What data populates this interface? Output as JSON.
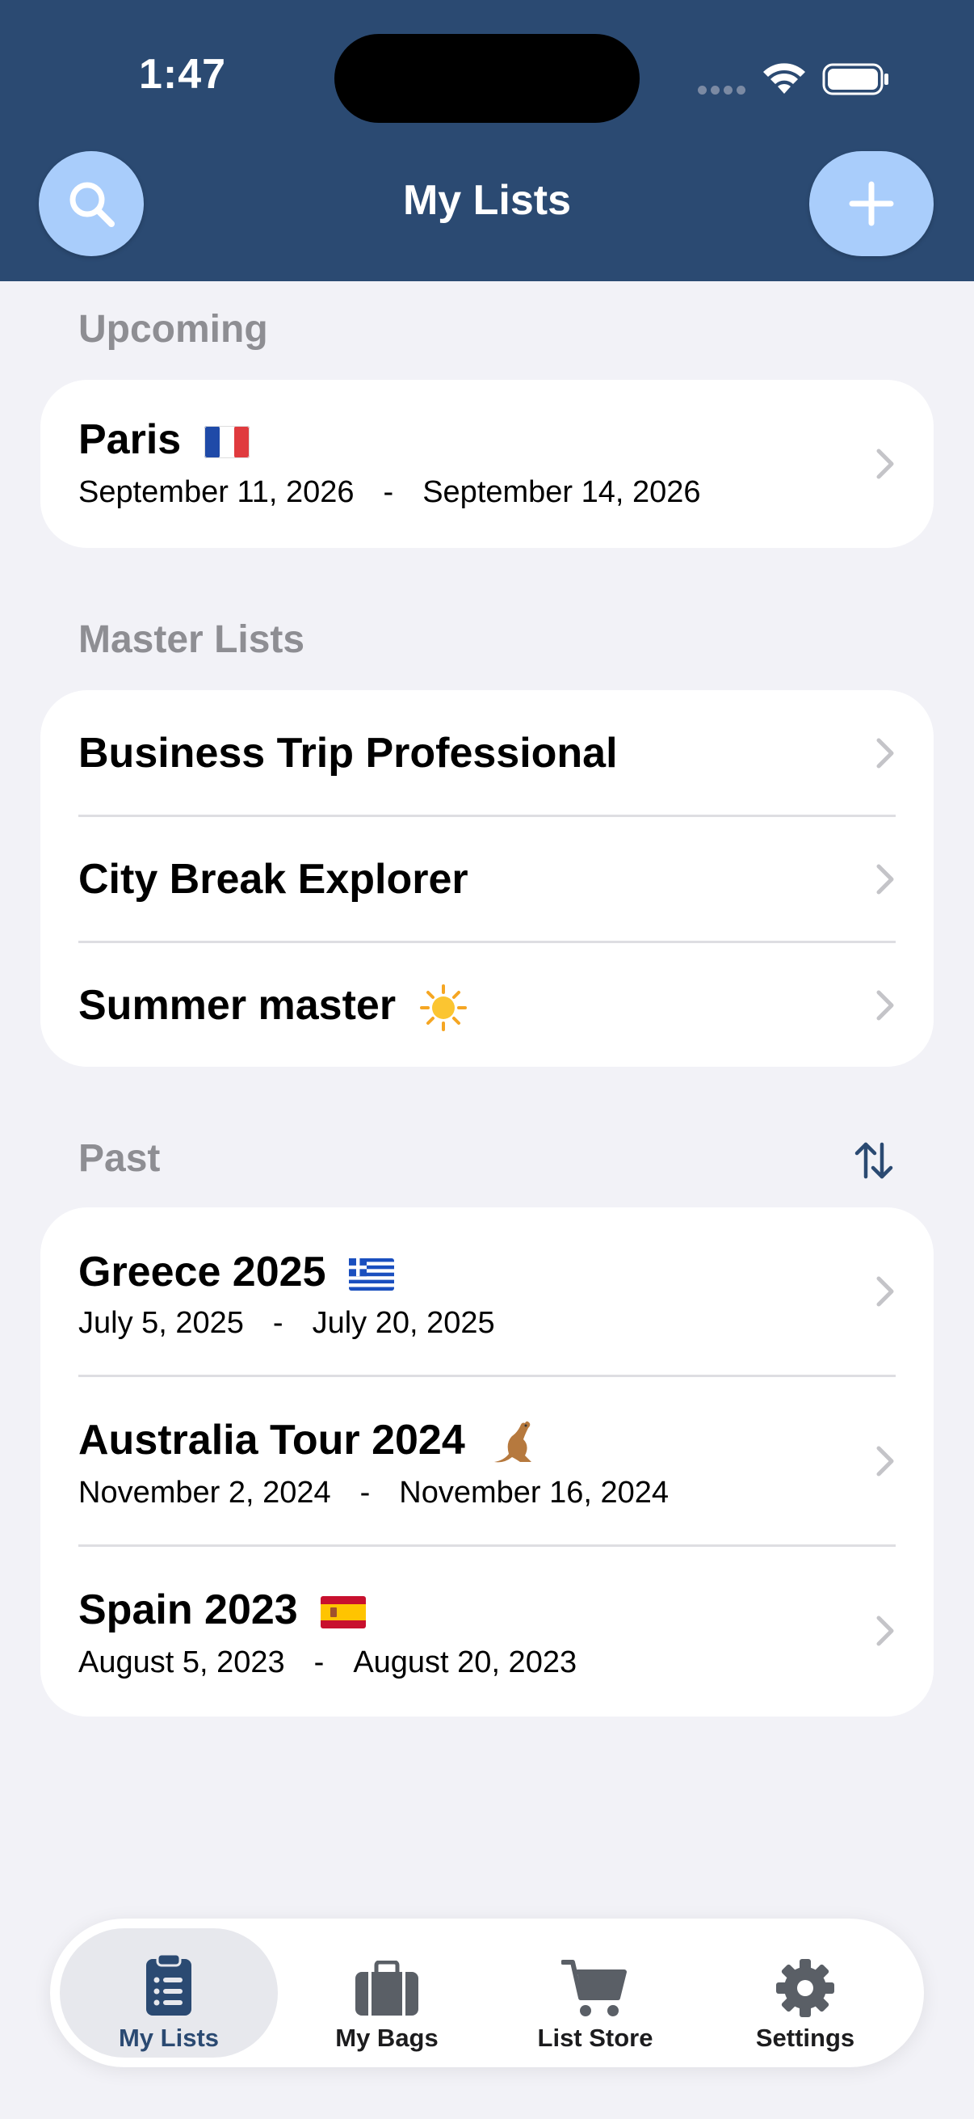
{
  "status": {
    "time": "1:47"
  },
  "nav": {
    "title": "My Lists"
  },
  "sections": {
    "upcoming": "Upcoming",
    "master": "Master Lists",
    "past": "Past"
  },
  "upcoming": [
    {
      "title": "Paris",
      "start": "September 11, 2026",
      "sep": "-",
      "end": "September 14, 2026"
    }
  ],
  "master": [
    {
      "title": "Business Trip Professional"
    },
    {
      "title": "City Break Explorer"
    },
    {
      "title": "Summer master"
    }
  ],
  "past": [
    {
      "title": "Greece 2025",
      "start": "July 5, 2025",
      "sep": "-",
      "end": "July 20, 2025"
    },
    {
      "title": "Australia Tour 2024",
      "start": "November 2, 2024",
      "sep": "-",
      "end": "November 16, 2024"
    },
    {
      "title": "Spain 2023",
      "start": "August 5, 2023",
      "sep": "-",
      "end": "August 20, 2023"
    }
  ],
  "tabs": [
    {
      "label": "My Lists",
      "icon": "clipboard-icon"
    },
    {
      "label": "My Bags",
      "icon": "suitcase-icon"
    },
    {
      "label": "List Store",
      "icon": "cart-icon"
    },
    {
      "label": "Settings",
      "icon": "gear-icon"
    }
  ],
  "colors": {
    "header": "#2b4a72",
    "button": "#a9cdfb",
    "background": "#f2f2f7",
    "secondary_text": "#8e8e93"
  }
}
